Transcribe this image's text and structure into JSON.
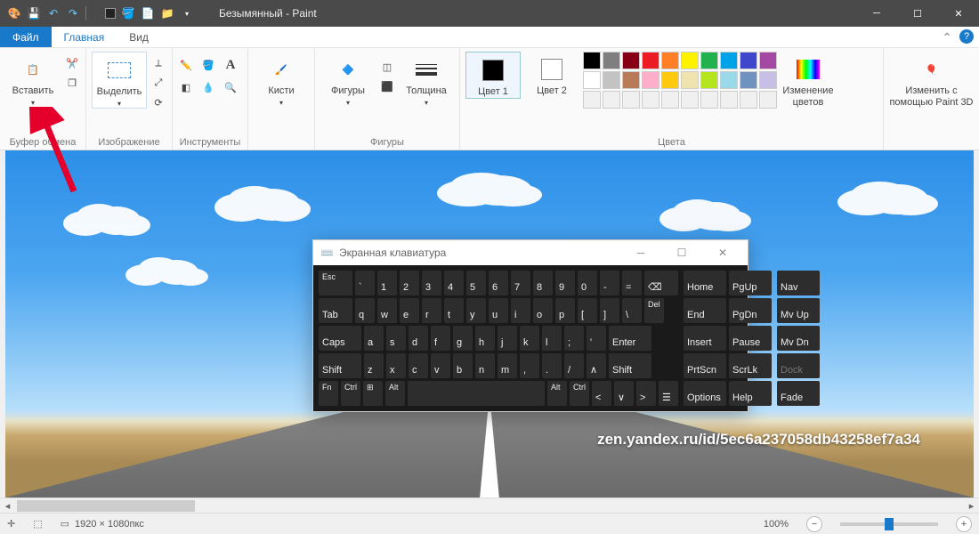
{
  "title": "Безымянный - Paint",
  "tabs": {
    "file": "Файл",
    "home": "Главная",
    "view": "Вид"
  },
  "ribbon": {
    "clipboard": {
      "paste": "Вставить",
      "label": "Буфер обмена"
    },
    "image": {
      "select": "Выделить",
      "label": "Изображение"
    },
    "tools": {
      "label": "Инструменты"
    },
    "brushes": {
      "btn": "Кисти"
    },
    "shapes": {
      "btn": "Фигуры",
      "outline": "Толщина",
      "label": "Фигуры"
    },
    "colors": {
      "c1": "Цвет 1",
      "c2": "Цвет 2",
      "edit": "Изменение цветов",
      "label": "Цвета",
      "palette": [
        "#000000",
        "#7f7f7f",
        "#880015",
        "#ed1c24",
        "#ff7f27",
        "#fff200",
        "#22b14c",
        "#00a2e8",
        "#3f48cc",
        "#a349a4",
        "#ffffff",
        "#c3c3c3",
        "#b97a57",
        "#ffaec9",
        "#ffc90e",
        "#efe4b0",
        "#b5e61d",
        "#99d9ea",
        "#7092be",
        "#c8bfe7",
        "#f0f0f0",
        "#f0f0f0",
        "#f0f0f0",
        "#f0f0f0",
        "#f0f0f0",
        "#f0f0f0",
        "#f0f0f0",
        "#f0f0f0",
        "#f0f0f0",
        "#f0f0f0"
      ]
    },
    "paint3d": {
      "btn": "Изменить с помощью Paint 3D"
    }
  },
  "osk": {
    "title": "Экранная клавиатура",
    "row1": [
      "Esc",
      "`",
      "1",
      "2",
      "3",
      "4",
      "5",
      "6",
      "7",
      "8",
      "9",
      "0",
      "-",
      "=",
      "⌫"
    ],
    "row2": [
      "Tab",
      "q",
      "w",
      "e",
      "r",
      "t",
      "y",
      "u",
      "i",
      "o",
      "p",
      "[",
      "]",
      "\\",
      "Del"
    ],
    "row3": [
      "Caps",
      "a",
      "s",
      "d",
      "f",
      "g",
      "h",
      "j",
      "k",
      "l",
      ";",
      "'",
      "Enter"
    ],
    "row4": [
      "Shift",
      "z",
      "x",
      "c",
      "v",
      "b",
      "n",
      "m",
      ",",
      ".",
      "/",
      "∧",
      "Shift"
    ],
    "row5": [
      "Fn",
      "Ctrl",
      "⊞",
      "Alt",
      " ",
      "Alt",
      "Ctrl",
      "<",
      "∨",
      ">",
      "☰"
    ],
    "nav": [
      "Home",
      "PgUp",
      "End",
      "PgDn",
      "Insert",
      "Pause",
      "PrtScn",
      "ScrLk",
      "Options",
      "Help"
    ],
    "ext": [
      "Nav",
      "Mv Up",
      "Mv Dn",
      "Dock",
      "Fade"
    ]
  },
  "status": {
    "dims": "1920 × 1080пкс",
    "zoom": "100%"
  },
  "watermark": "zen.yandex.ru/id/5ec6a237058db43258ef7a34"
}
